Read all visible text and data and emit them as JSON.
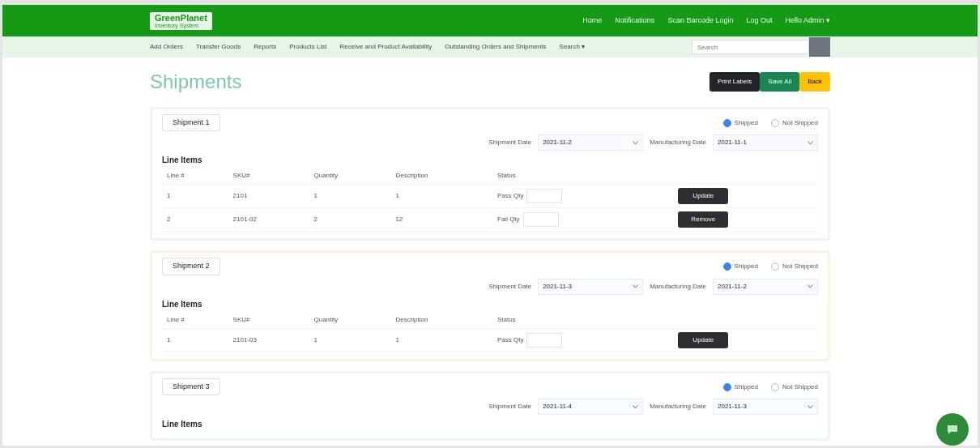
{
  "brand": {
    "name": "GreenPlanet",
    "tagline": "Inventory System"
  },
  "top_nav": [
    "Home",
    "Notifications",
    "Scan Barcode Login",
    "Log Out",
    "Hello Admin ▾"
  ],
  "sub_nav": [
    "Add Orders",
    "Transfer Goods",
    "Reports",
    "Products List",
    "Receive and Product Availability",
    "Outstanding Orders and Shipments",
    "Search ▾"
  ],
  "search": {
    "placeholder": "Search"
  },
  "page_title": "Shipments",
  "actions": [
    {
      "label": "Print Labels",
      "kind": "dark"
    },
    {
      "label": "Save All",
      "kind": "success"
    },
    {
      "label": "Back",
      "kind": "warning"
    }
  ],
  "shipments": [
    {
      "title": "Shipment 1",
      "color": "#e9f7ef",
      "options": [
        {
          "label": "Shipped",
          "selected": true
        },
        {
          "label": "Not Shipped",
          "selected": false
        }
      ],
      "shipment_date": {
        "label": "Shipment Date",
        "value": "2021-11-2"
      },
      "mfg_date": {
        "label": "Manufacturing Date",
        "value": "2021-11-1"
      },
      "items_title": "Line Items",
      "columns": [
        "Line #",
        "SKU#",
        "Quantity",
        "Description",
        "Status"
      ],
      "rows": [
        {
          "cells": [
            "1",
            "2101",
            "1",
            "1"
          ],
          "status_label": "Pass Qty"
        },
        {
          "cells": [
            "2",
            "2101-02",
            "2",
            "12"
          ],
          "status_label": "Fail Qty"
        }
      ],
      "buttons": [
        "Update",
        "Remove"
      ]
    },
    {
      "title": "Shipment 2",
      "color": "#fdf3dc",
      "options": [
        {
          "label": "Shipped",
          "selected": true
        },
        {
          "label": "Not Shipped",
          "selected": false
        }
      ],
      "shipment_date": {
        "label": "Shipment Date",
        "value": "2021-11-3"
      },
      "mfg_date": {
        "label": "Manufacturing Date",
        "value": "2021-11-2"
      },
      "items_title": "Line Items",
      "columns": [
        "Line #",
        "SKU#",
        "Quantity",
        "Description",
        "Status"
      ],
      "rows": [
        {
          "cells": [
            "1",
            "2101-03",
            "1",
            "1"
          ],
          "status_label": "Pass Qty"
        }
      ],
      "buttons": [
        "Update"
      ]
    },
    {
      "title": "Shipment 3",
      "color": "#e9f7ef",
      "options": [
        {
          "label": "Shipped",
          "selected": true
        },
        {
          "label": "Not Shipped",
          "selected": false
        }
      ],
      "shipment_date": {
        "label": "Shipment Date",
        "value": "2021-11-4"
      },
      "mfg_date": {
        "label": "Manufacturing Date",
        "value": "2021-11-3"
      },
      "items_title": "Line Items"
    }
  ]
}
